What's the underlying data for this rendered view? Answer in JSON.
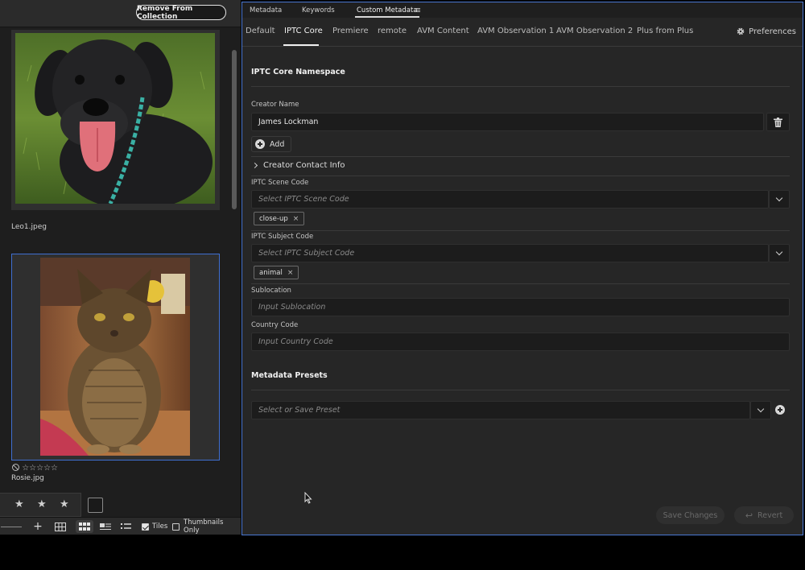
{
  "left": {
    "remove_button": "Remove From Collection",
    "items": [
      {
        "filename": "Leo1.jpeg"
      },
      {
        "filename": "Rosie.jpg",
        "rating": 0
      }
    ],
    "rating_glyphs": "⃠☆☆☆☆☆",
    "bottom": {
      "tiles_label": "Tiles",
      "tiles_checked": true,
      "thumbs_only_label": "Thumbnails Only",
      "thumbs_only_checked": false
    }
  },
  "tabs_top": [
    {
      "label": "Metadata"
    },
    {
      "label": "Keywords"
    },
    {
      "label": "Custom Metadata"
    }
  ],
  "tabs": [
    {
      "label": "Default"
    },
    {
      "label": "IPTC Core"
    },
    {
      "label": "Premiere"
    },
    {
      "label": "remote"
    },
    {
      "label": "AVM Content"
    },
    {
      "label": "AVM Observation 1"
    },
    {
      "label": "AVM Observation 2"
    },
    {
      "label": "Plus from Plus"
    }
  ],
  "active_tab": "IPTC Core",
  "preferences_label": "Preferences",
  "namespace": {
    "title": "IPTC Core Namespace",
    "creator_label": "Creator Name",
    "creator_value": "James Lockman",
    "add_label": "Add",
    "contact_info": "Creator Contact Info",
    "scene_label": "IPTC Scene Code",
    "scene_placeholder": "Select IPTC Scene Code",
    "scene_chip": "close-up",
    "subject_label": "IPTC Subject Code",
    "subject_placeholder": "Select IPTC Subject Code",
    "subject_chip": "animal",
    "sublocation_label": "Sublocation",
    "sublocation_placeholder": "Input Sublocation",
    "country_label": "Country Code",
    "country_placeholder": "Input Country Code"
  },
  "presets": {
    "title": "Metadata Presets",
    "placeholder": "Select or Save Preset"
  },
  "footer": {
    "save": "Save Changes",
    "revert": "Revert"
  },
  "colors": {
    "selection_border": "#3f6fd1",
    "background": "#262626"
  },
  "icons": [
    "star-icon",
    "grid-icon",
    "tiles-icon",
    "detail-view-icon",
    "list-icon",
    "gear-icon",
    "trash-icon",
    "chevron-right-icon",
    "chevron-down-icon",
    "plus-circle-icon",
    "revert-icon",
    "hamburger-icon",
    "no-rating-icon"
  ]
}
